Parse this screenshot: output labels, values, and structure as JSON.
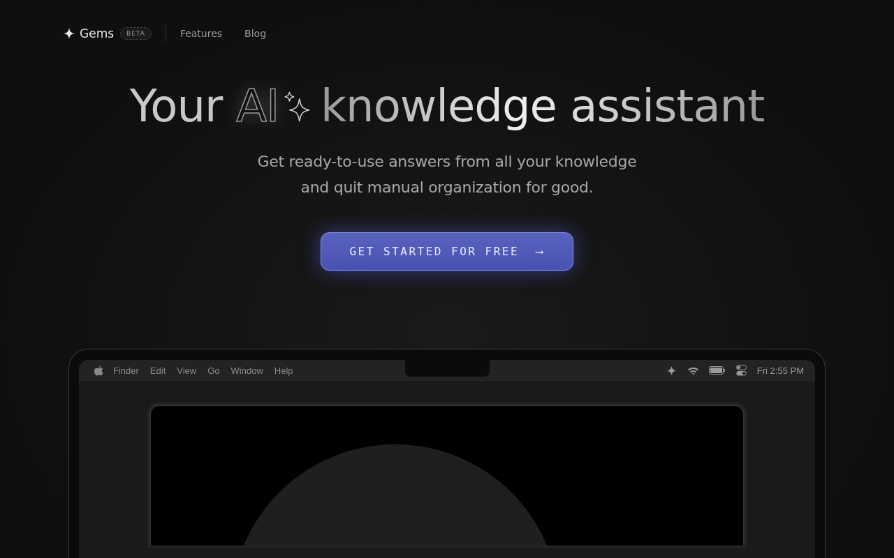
{
  "nav": {
    "brand": "Gems",
    "badge": "BETA",
    "links": [
      {
        "label": "Features"
      },
      {
        "label": "Blog"
      }
    ]
  },
  "hero": {
    "title_start": "Your",
    "title_ai": "AI",
    "title_end": "knowledge assistant",
    "subtitle_lines": [
      "Get ready-to-use answers from all your knowledge",
      "and quit manual organization for good."
    ],
    "cta": "GET STARTED FOR FREE",
    "cta_arrow": "⟶"
  },
  "laptop": {
    "menu": [
      "Finder",
      "Edit",
      "View",
      "Go",
      "Window",
      "Help"
    ],
    "clock": "Fri 2:55 PM"
  }
}
